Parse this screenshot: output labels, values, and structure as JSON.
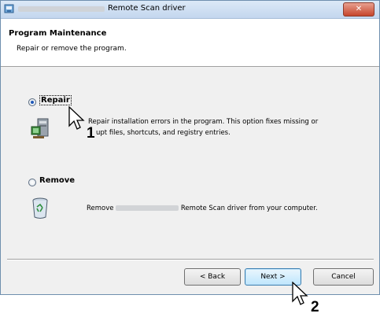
{
  "window": {
    "title": "Remote Scan driver",
    "close_glyph": "✕"
  },
  "header": {
    "title": "Program Maintenance",
    "subtitle": "Repair or remove the program."
  },
  "options": {
    "repair": {
      "label": "Repair",
      "checked": true,
      "description_line1": "Repair installation errors in the program. This option fixes missing or",
      "description_line2": "upt files, shortcuts, and registry entries."
    },
    "remove": {
      "label": "Remove",
      "checked": false,
      "description_prefix": "Remove",
      "description_suffix": "Remote Scan driver from your computer."
    }
  },
  "buttons": {
    "back": "< Back",
    "next": "Next >",
    "cancel": "Cancel"
  },
  "annotations": {
    "step1": "1",
    "step2": "2"
  },
  "colors": {
    "accent": "#1f59b8",
    "close": "#c6452c"
  }
}
